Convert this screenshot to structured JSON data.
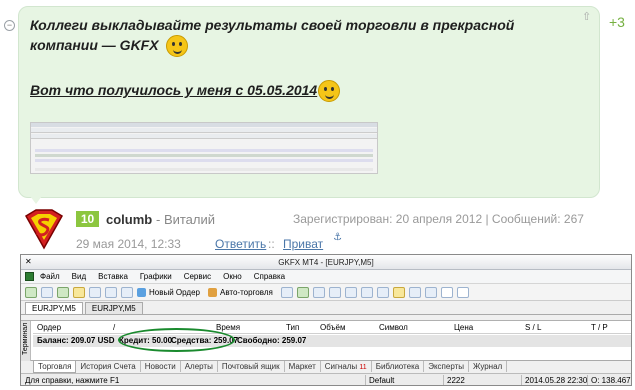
{
  "post": {
    "collapse_icon": "minus-circle-icon",
    "text": "Коллеги выкладывайте результаты своей торговли в прекрасной компании — GKFX",
    "subtitle": "Вот что получилось у меня с 05.05.2014",
    "score": "+3",
    "bubble_color": "#e7f5e3"
  },
  "author": {
    "level": "10",
    "username": "columb",
    "realname": "- Виталий",
    "registered": "Зарегистрирован: 20 апреля 2012 | Сообщений: 267",
    "date": "29 мая 2014, 12:33",
    "reply_label": "Ответить",
    "sep": "::",
    "private_label": "Приват",
    "level_color": "#8cc63f",
    "link_color": "#4a76a8"
  },
  "mt4": {
    "title": "GKFX MT4 - [EURJPY,M5]",
    "menu": [
      "Файл",
      "Вид",
      "Вставка",
      "Графики",
      "Сервис",
      "Окно",
      "Справка"
    ],
    "toolbar_new_order": "Новый Ордер",
    "toolbar_autotrading": "Авто-торговля",
    "chart_tabs": [
      "EURJPY,M5",
      "EURJPY,M5"
    ],
    "columns": [
      "Ордер",
      "/",
      "Время",
      "Тип",
      "Объём",
      "Символ",
      "Цена",
      "S / L",
      "T / P"
    ],
    "balance_row": {
      "balance": "Баланс: 209.07 USD",
      "credit": "Кредит: 50.00",
      "equity": "Средства: 259.07",
      "free": "Свободно: 259.07"
    },
    "terminal_label": "Терминал",
    "bottom_tabs": [
      "Торговля",
      "История Счета",
      "Новости",
      "Алерты",
      "Почтовый ящик",
      "Маркет",
      "Сигналы",
      "Библиотека",
      "Эксперты",
      "Журнал"
    ],
    "signals_badge": "11",
    "status": {
      "help": "Для справки, нажмите F1",
      "default": "Default",
      "count": "2222",
      "datetime": "2014.05.28 22:30",
      "open": "O: 138.467"
    },
    "highlight_color": "#1a8a2e"
  }
}
